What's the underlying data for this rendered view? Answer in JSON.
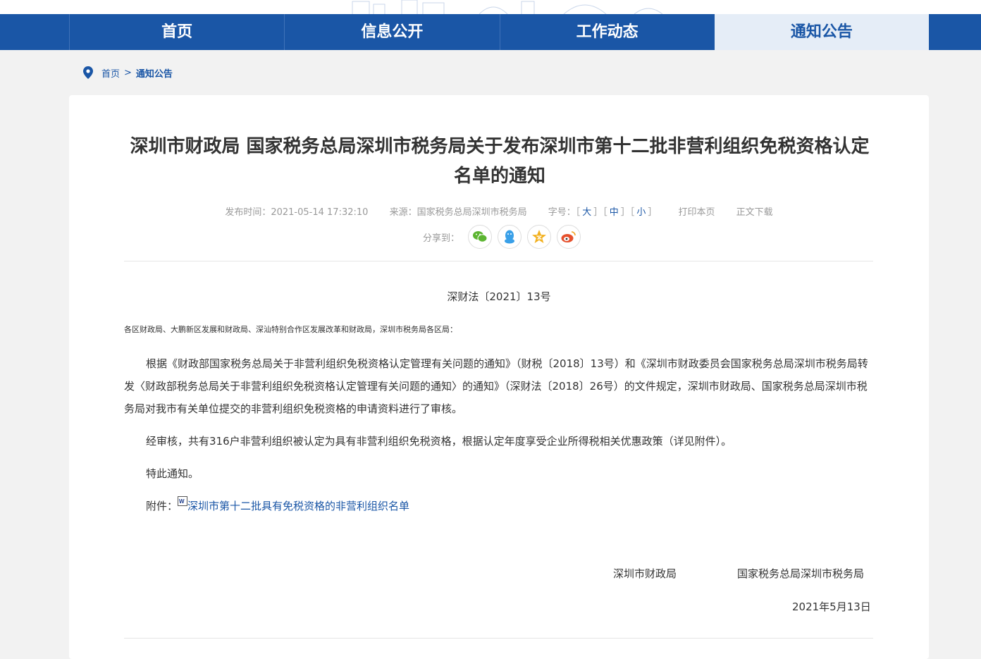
{
  "nav": {
    "items": [
      "首页",
      "信息公开",
      "工作动态",
      "通知公告"
    ],
    "active_index": 3
  },
  "breadcrumb": {
    "home": "首页",
    "sep": ">",
    "current": "通知公告"
  },
  "article": {
    "title": "深圳市财政局 国家税务总局深圳市税务局关于发布深圳市第十二批非营利组织免税资格认定名单的通知",
    "meta": {
      "publish_label": "发布时间：",
      "publish_time": "2021-05-14 17:32:10",
      "source_label": "来源：",
      "source": "国家税务总局深圳市税务局",
      "font_label": "字号：",
      "font_large": "大",
      "font_medium": "中",
      "font_small": "小",
      "print": "打印本页",
      "download": "正文下载"
    },
    "share_label": "分享到：",
    "doc_number": "深财法〔2021〕13号",
    "addressee": "各区财政局、大鹏新区发展和财政局、深汕特别合作区发展改革和财政局，深圳市税务局各区局：",
    "paragraphs": [
      "根据《财政部国家税务总局关于非营利组织免税资格认定管理有关问题的通知》（财税〔2018〕13号）和《深圳市财政委员会国家税务总局深圳市税务局转发〈财政部税务总局关于非营利组织免税资格认定管理有关问题的通知〉的通知》（深财法〔2018〕26号）的文件规定，深圳市财政局、国家税务总局深圳市税务局对我市有关单位提交的非营利组织免税资格的申请资料进行了审核。",
      "经审核，共有316户非营利组织被认定为具有非营利组织免税资格，根据认定年度享受企业所得税相关优惠政策（详见附件）。",
      "特此通知。"
    ],
    "attachment_label": "附件：",
    "attachment_link": "深圳市第十二批具有免税资格的非营利组织名单",
    "signer1": "深圳市财政局",
    "signer2": "国家税务总局深圳市税务局",
    "date": "2021年5月13日"
  },
  "colors": {
    "nav_bg": "#1a56a6",
    "nav_active_bg": "#e5edf7",
    "link": "#1a56a6",
    "wechat": "#5cb531",
    "qq": "#3aa0e8",
    "qzone": "#f2b01e",
    "weibo": "#e6502c"
  },
  "icons": [
    "location-pin-icon",
    "wechat-icon",
    "qq-icon",
    "qzone-icon",
    "weibo-icon",
    "word-doc-icon"
  ]
}
